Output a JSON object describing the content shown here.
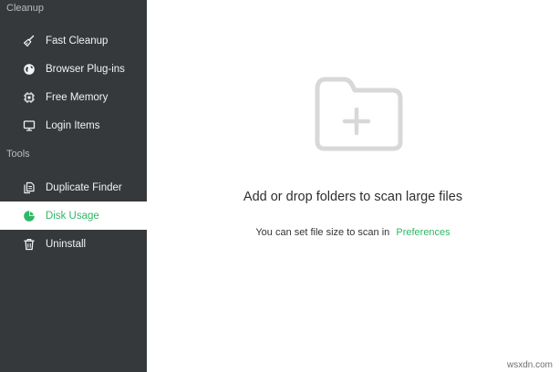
{
  "sidebar": {
    "sections": [
      {
        "label": "Cleanup"
      },
      {
        "label": "Tools"
      }
    ],
    "items": [
      {
        "label": "Fast Cleanup",
        "icon": "broom-icon"
      },
      {
        "label": "Browser Plug-ins",
        "icon": "globe-icon"
      },
      {
        "label": "Free Memory",
        "icon": "chip-icon"
      },
      {
        "label": "Login Items",
        "icon": "monitor-icon"
      },
      {
        "label": "Duplicate Finder",
        "icon": "duplicate-files-icon"
      },
      {
        "label": "Disk Usage",
        "icon": "pie-chart-icon",
        "active": true
      },
      {
        "label": "Uninstall",
        "icon": "trash-icon"
      }
    ]
  },
  "main": {
    "drop_icon": "folder-plus-icon",
    "headline": "Add or drop folders to scan large files",
    "hint": "You can set file size to scan in",
    "preferences_link": "Preferences"
  },
  "watermark": "wsxdn.com",
  "colors": {
    "sidebar_bg": "#35393c",
    "accent": "#2fb867",
    "placeholder_icon": "#d8d8d8"
  }
}
